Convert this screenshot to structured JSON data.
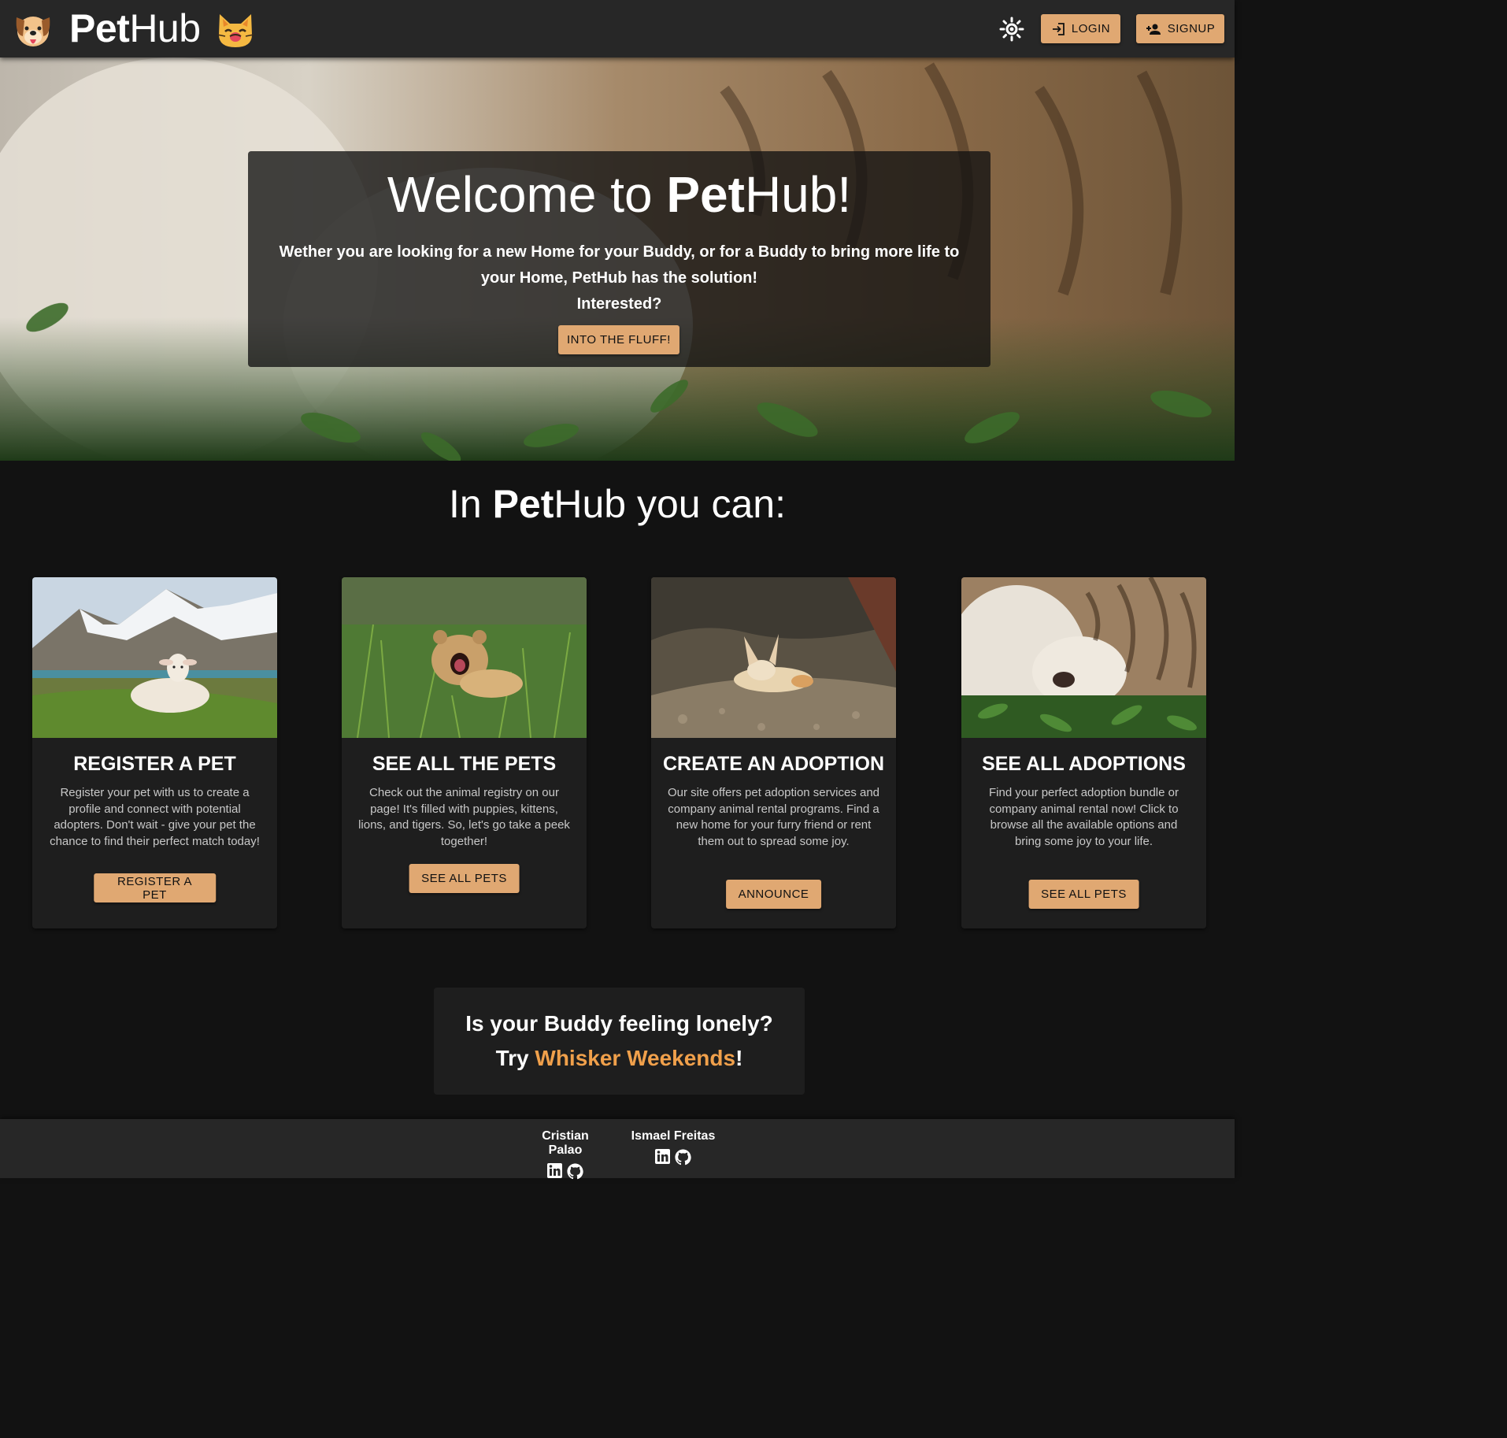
{
  "navbar": {
    "brand_bold": "Pet",
    "brand_light": "Hub",
    "login_label": "LOGIN",
    "signup_label": "SIGNUP"
  },
  "hero": {
    "title_prefix": "Welcome to ",
    "title_bold": "Pet",
    "title_light": "Hub!",
    "text_line1": "Wether you are looking for a new Home for your Buddy, or for a Buddy to bring more life to your Home, PetHub has the solution!",
    "text_line2": "Interested?",
    "button_label": "INTO THE FLUFF!"
  },
  "features": {
    "title_prefix": "In ",
    "title_bold": "Pet",
    "title_suffix": "Hub you can:",
    "cards": [
      {
        "title": "REGISTER A PET",
        "description": "Register your pet with us to create a profile and connect with potential adopters. Don't wait - give your pet the chance to find their perfect match today!",
        "button": "REGISTER A PET"
      },
      {
        "title": "SEE ALL THE PETS",
        "description": "Check out the animal registry on our page! It's filled with puppies, kittens, lions, and tigers. So, let's go take a peek together!",
        "button": "SEE ALL PETS"
      },
      {
        "title": "CREATE AN ADOPTION",
        "description": "Our site offers pet adoption services and company animal rental programs. Find a new home for your furry friend or rent them out to spread some joy.",
        "button": "ANNOUNCE"
      },
      {
        "title": "SEE ALL ADOPTIONS",
        "description": "Find your perfect adoption bundle or company animal rental now! Click to browse all the available options and bring some joy to your life.",
        "button": "SEE ALL PETS"
      }
    ]
  },
  "promo": {
    "line1": "Is your Buddy feeling lonely?",
    "line2_prefix": "Try ",
    "line2_accent": "Whisker Weekends",
    "line2_suffix": "!"
  },
  "footer": {
    "authors": [
      {
        "name": "Cristian Palao"
      },
      {
        "name": "Ismael Freitas"
      }
    ]
  },
  "icons": {
    "logo": "dog-face-icon",
    "brand_emoji": "cat-face-icon",
    "theme": "sun-icon",
    "login": "login-icon",
    "signup": "person-add-icon",
    "linkedin": "linkedin-icon",
    "github": "github-icon"
  },
  "colors": {
    "accent_button": "#e0a872",
    "promo_accent": "#f0a04b",
    "navbar_bg": "#272727",
    "page_bg": "#121212",
    "card_bg": "#1e1e1e"
  }
}
